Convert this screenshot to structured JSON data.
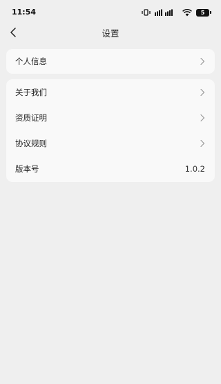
{
  "status_bar": {
    "time": "11:54",
    "battery": "5"
  },
  "nav": {
    "title": "设置"
  },
  "section1": {
    "items": [
      {
        "label": "个人信息"
      }
    ]
  },
  "section2": {
    "items": [
      {
        "label": "关于我们"
      },
      {
        "label": "资质证明"
      },
      {
        "label": "协议规则"
      }
    ],
    "version": {
      "label": "版本号",
      "value": "1.0.2"
    }
  },
  "icons": [
    "back-arrow-icon",
    "chevron-right-icon",
    "signal-icon",
    "wifi-icon",
    "battery-icon",
    "vibrate-icon"
  ]
}
